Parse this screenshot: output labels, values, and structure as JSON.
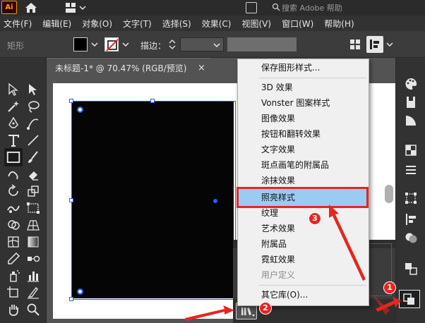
{
  "titlebar": {
    "logo": "Ai",
    "search_placeholder": "搜索 Adobe 帮助"
  },
  "menubar": {
    "items": [
      "文件(F)",
      "编辑(E)",
      "对象(O)",
      "文字(T)",
      "选择(S)",
      "效果(C)",
      "视图(V)",
      "窗口(W)",
      "帮助(H)"
    ]
  },
  "controlbar": {
    "shape_label": "矩形",
    "stroke_label": "描边：",
    "fill_color": "#000000"
  },
  "document": {
    "tab_title": "未标题-1* @ 70.47% (RGB/预览)",
    "close_glyph": "×"
  },
  "dropdown": {
    "items": [
      {
        "label": "保存图形样式...",
        "enabled": true
      },
      {
        "label": "3D 效果",
        "enabled": true
      },
      {
        "label": "Vonster 图案样式",
        "enabled": true
      },
      {
        "label": "图像效果",
        "enabled": true
      },
      {
        "label": "按钮和翻转效果",
        "enabled": true
      },
      {
        "label": "文字效果",
        "enabled": true
      },
      {
        "label": "斑点画笔的附属品",
        "enabled": true
      },
      {
        "label": "涂抹效果",
        "enabled": true
      },
      {
        "label": "照亮样式",
        "enabled": true,
        "highlighted": true
      },
      {
        "label": "纹理",
        "enabled": true
      },
      {
        "label": "艺术效果",
        "enabled": true
      },
      {
        "label": "附属品",
        "enabled": true
      },
      {
        "label": "霓虹效果",
        "enabled": true
      },
      {
        "label": "用户定义",
        "enabled": false,
        "submenu": true
      },
      {
        "label": "其它库(O)...",
        "enabled": true
      }
    ],
    "submenu_arrow": "›"
  },
  "callouts": {
    "badge_1": "1",
    "badge_2": "2",
    "badge_3": "3",
    "color": "#e8251f"
  },
  "colors": {
    "selection": "#2a5bff",
    "highlight": "#9ccbf1",
    "brand": "#ff9a00"
  }
}
